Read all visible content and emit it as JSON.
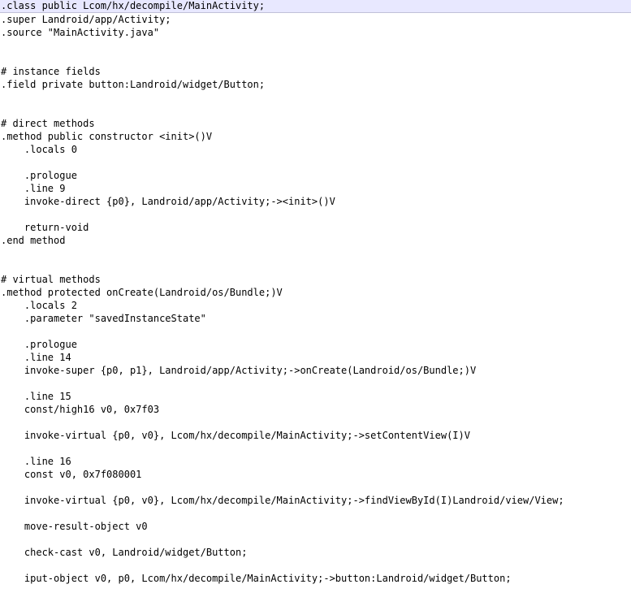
{
  "editor": {
    "lines": [
      ".class public Lcom/hx/decompile/MainActivity;",
      ".super Landroid/app/Activity;",
      ".source \"MainActivity.java\"",
      "",
      "",
      "# instance fields",
      ".field private button:Landroid/widget/Button;",
      "",
      "",
      "# direct methods",
      ".method public constructor <init>()V",
      "    .locals 0",
      "",
      "    .prologue",
      "    .line 9",
      "    invoke-direct {p0}, Landroid/app/Activity;-><init>()V",
      "",
      "    return-void",
      ".end method",
      "",
      "",
      "# virtual methods",
      ".method protected onCreate(Landroid/os/Bundle;)V",
      "    .locals 2",
      "    .parameter \"savedInstanceState\"",
      "",
      "    .prologue",
      "    .line 14",
      "    invoke-super {p0, p1}, Landroid/app/Activity;->onCreate(Landroid/os/Bundle;)V",
      "",
      "    .line 15",
      "    const/high16 v0, 0x7f03",
      "",
      "    invoke-virtual {p0, v0}, Lcom/hx/decompile/MainActivity;->setContentView(I)V",
      "",
      "    .line 16",
      "    const v0, 0x7f080001",
      "",
      "    invoke-virtual {p0, v0}, Lcom/hx/decompile/MainActivity;->findViewById(I)Landroid/view/View;",
      "",
      "    move-result-object v0",
      "",
      "    check-cast v0, Landroid/widget/Button;",
      "",
      "    iput-object v0, p0, Lcom/hx/decompile/MainActivity;->button:Landroid/widget/Button;",
      ""
    ]
  }
}
